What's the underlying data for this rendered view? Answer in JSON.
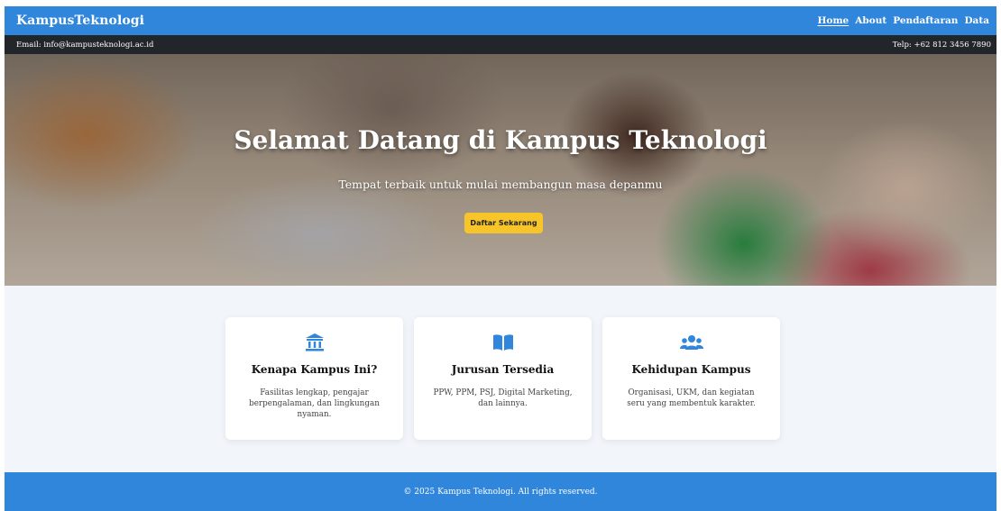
{
  "navbar": {
    "brand": "KampusTeknologi",
    "links": [
      "Home",
      "About",
      "Pendaftaran",
      "Data"
    ]
  },
  "infobar": {
    "email": "Email: info@kampusteknologi.ac.id",
    "phone": "Telp: +62 812 3456 7890"
  },
  "hero": {
    "title": "Selamat Datang di Kampus Teknologi",
    "subtitle": "Tempat terbaik untuk mulai membangun masa depanmu",
    "button_label": "Daftar Sekarang"
  },
  "cards": [
    {
      "icon": "university-icon",
      "title": "Kenapa Kampus Ini?",
      "text": "Fasilitas lengkap, pengajar berpengalaman, dan lingkungan nyaman."
    },
    {
      "icon": "book-icon",
      "title": "Jurusan Tersedia",
      "text": "PPW, PPM, PSJ, Digital Marketing, dan lainnya."
    },
    {
      "icon": "users-icon",
      "title": "Kehidupan Kampus",
      "text": "Organisasi, UKM, dan kegiatan seru yang membentuk karakter."
    }
  ],
  "footer": {
    "text": "© 2025 Kampus Teknologi. All rights reserved."
  },
  "colors": {
    "primary": "#2f86db",
    "accent": "#f7c529",
    "infobar": "#22262b"
  }
}
